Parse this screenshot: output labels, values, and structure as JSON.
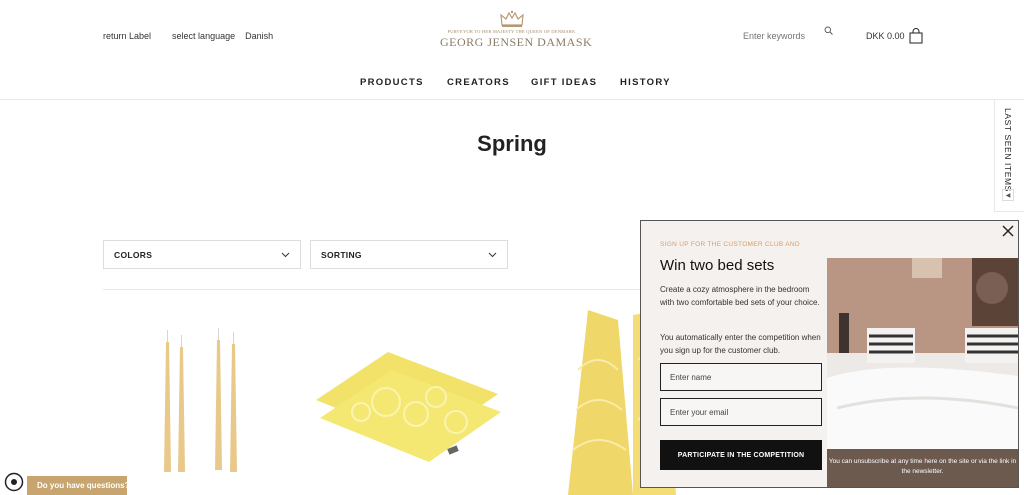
{
  "header": {
    "return_label": "return Label",
    "select_language": "select language",
    "language": "Danish",
    "logo_tagline": "PURVEYOR TO HER MAJESTY THE QUEEN OF DENMARK",
    "logo_name": "GEORG JENSEN DAMASK",
    "search_placeholder": "Enter keywords",
    "cart_amount": "DKK 0.00"
  },
  "nav": [
    "PRODUCTS",
    "CREATORS",
    "GIFT IDEAS",
    "HISTORY"
  ],
  "last_seen": "LAST SEEN ITEMS",
  "page_title": "Spring",
  "filters": {
    "colors": "COLORS",
    "sorting": "SORTING"
  },
  "popup": {
    "kicker": "SIGN UP FOR THE CUSTOMER CLUB AND",
    "title": "Win two bed sets",
    "paragraph1": "Create a cozy atmosphere in the bedroom with two comfortable bed sets of your choice.",
    "paragraph2": "You automatically enter the competition when you sign up for the customer club.",
    "name_placeholder": "Enter name",
    "email_placeholder": "Enter your email",
    "button": "PARTICIPATE IN THE COMPETITION",
    "footer": "You can unsubscribe at any time here on the site or via the link in the newsletter."
  },
  "chat": {
    "label": "Do you have questions?"
  },
  "colors": {
    "accent": "#c8a56f",
    "kicker": "#d2a068",
    "logo": "#8c7b66"
  }
}
